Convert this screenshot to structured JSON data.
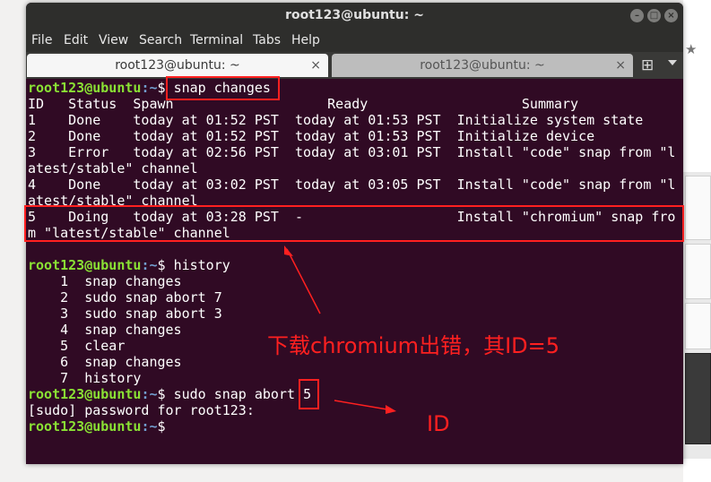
{
  "window": {
    "title": "root123@ubuntu: ~",
    "menu": [
      "File",
      "Edit",
      "View",
      "Search",
      "Terminal",
      "Tabs",
      "Help"
    ],
    "tabs": [
      {
        "label": "root123@ubuntu: ~",
        "active": true
      },
      {
        "label": "root123@ubuntu: ~",
        "active": false
      }
    ],
    "tab_close": "×",
    "tab_add": "⊞"
  },
  "terminal": {
    "prompt_user": "root123@ubuntu",
    "prompt_path": ":~",
    "prompt_symbol": "$ ",
    "cmd1": "snap changes",
    "header": "ID   Status  Spawn                   Ready                   Summary",
    "rows": [
      "1    Done    today at 01:52 PST  today at 01:53 PST  Initialize system state",
      "2    Done    today at 01:52 PST  today at 01:53 PST  Initialize device",
      "3    Error   today at 02:56 PST  today at 03:01 PST  Install \"code\" snap from \"l",
      "atest/stable\" channel",
      "4    Done    today at 03:02 PST  today at 03:05 PST  Install \"code\" snap from \"l",
      "atest/stable\" channel",
      "5    Doing   today at 03:28 PST  -                   Install \"chromium\" snap fro",
      "m \"latest/stable\" channel"
    ],
    "cmd2": "history",
    "history": [
      "    1  snap changes",
      "    2  sudo snap abort 7",
      "    3  sudo snap abort 3",
      "    4  snap changes",
      "    5  clear",
      "    6  snap changes",
      "    7  history"
    ],
    "cmd3": "sudo snap abort ",
    "cmd3_id": "5",
    "sudo_prompt": "[sudo] password for root123:"
  },
  "annotations": {
    "error_note": "下载chromium出错，其ID=5",
    "id_note": "ID"
  },
  "colors": {
    "terminal_bg": "#300a24",
    "prompt_user": "#8ae234",
    "prompt_path": "#729fcf",
    "annotation": "#ff2020"
  }
}
